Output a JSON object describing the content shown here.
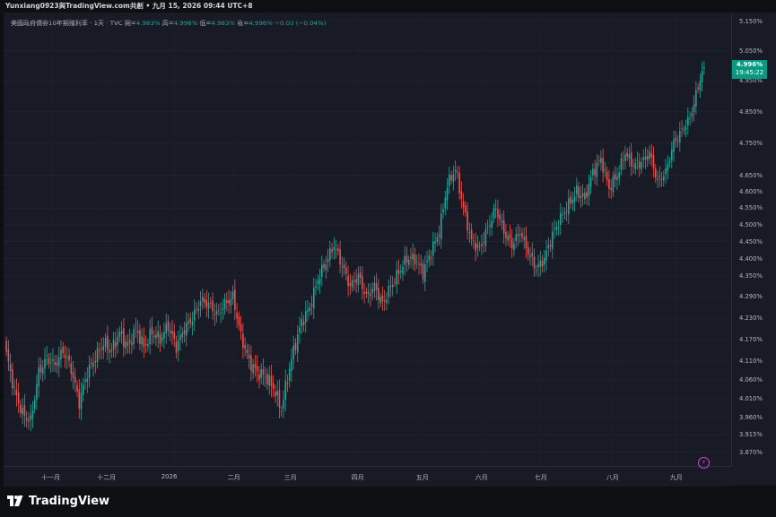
{
  "header": {
    "share_line": "Yunxiang0923與TradingView.com共創 • 九月 15, 2026 09:44 UTC+8"
  },
  "legend": {
    "symbol": "美國政府債券10年期殖利率 · 1天 · TVC",
    "open_label": "開=",
    "open_value": "4.983%",
    "high_label": "高=",
    "high_value": "4.996%",
    "low_label": "低=",
    "low_value": "4.983%",
    "close_label": "收=",
    "close_value": "4.996%",
    "change": "−0.00 (−0.04%)"
  },
  "last_price": {
    "value": "4.996%",
    "countdown": "19:45:22"
  },
  "footer": {
    "brand": "TradingView"
  },
  "colors": {
    "up": "#26a69a",
    "down": "#ef5350",
    "badge": "#089981",
    "bg": "#181a25"
  },
  "chart_data": {
    "type": "candlestick",
    "title": "美國政府債券10年期殖利率 · 1天 · TVC",
    "y_scale": "log",
    "ylim": [
      3.835,
      5.18
    ],
    "y_ticks": [
      "5.150%",
      "5.050%",
      "4.950%",
      "4.850%",
      "4.750%",
      "4.650%",
      "4.600%",
      "4.550%",
      "4.500%",
      "4.450%",
      "4.400%",
      "4.350%",
      "4.290%",
      "4.230%",
      "4.170%",
      "4.110%",
      "4.060%",
      "4.010%",
      "3.960%",
      "3.915%",
      "3.870%"
    ],
    "x_ticks": [
      "十一月",
      "十二月",
      "2026",
      "二月",
      "三月",
      "四月",
      "五月",
      "六月",
      "七月",
      "八月",
      "九月"
    ],
    "anchors": [
      [
        0,
        4.13
      ],
      [
        4,
        4.03
      ],
      [
        8,
        3.97
      ],
      [
        12,
        3.95
      ],
      [
        16,
        4.08
      ],
      [
        20,
        4.12
      ],
      [
        24,
        4.1
      ],
      [
        28,
        4.14
      ],
      [
        32,
        4.09
      ],
      [
        36,
        4.0
      ],
      [
        40,
        4.08
      ],
      [
        44,
        4.12
      ],
      [
        48,
        4.16
      ],
      [
        52,
        4.14
      ],
      [
        56,
        4.19
      ],
      [
        60,
        4.15
      ],
      [
        64,
        4.2
      ],
      [
        68,
        4.15
      ],
      [
        72,
        4.19
      ],
      [
        76,
        4.17
      ],
      [
        80,
        4.21
      ],
      [
        84,
        4.15
      ],
      [
        88,
        4.2
      ],
      [
        92,
        4.23
      ],
      [
        96,
        4.28
      ],
      [
        100,
        4.27
      ],
      [
        104,
        4.24
      ],
      [
        108,
        4.27
      ],
      [
        112,
        4.29
      ],
      [
        116,
        4.18
      ],
      [
        120,
        4.11
      ],
      [
        124,
        4.08
      ],
      [
        128,
        4.07
      ],
      [
        132,
        4.04
      ],
      [
        136,
        3.98
      ],
      [
        138,
        4.04
      ],
      [
        142,
        4.14
      ],
      [
        146,
        4.22
      ],
      [
        150,
        4.26
      ],
      [
        154,
        4.34
      ],
      [
        158,
        4.39
      ],
      [
        162,
        4.44
      ],
      [
        166,
        4.38
      ],
      [
        170,
        4.32
      ],
      [
        174,
        4.35
      ],
      [
        178,
        4.29
      ],
      [
        182,
        4.32
      ],
      [
        186,
        4.27
      ],
      [
        190,
        4.32
      ],
      [
        194,
        4.36
      ],
      [
        198,
        4.4
      ],
      [
        202,
        4.4
      ],
      [
        206,
        4.36
      ],
      [
        210,
        4.42
      ],
      [
        214,
        4.48
      ],
      [
        218,
        4.62
      ],
      [
        222,
        4.67
      ],
      [
        226,
        4.55
      ],
      [
        230,
        4.45
      ],
      [
        234,
        4.43
      ],
      [
        238,
        4.49
      ],
      [
        242,
        4.55
      ],
      [
        246,
        4.48
      ],
      [
        250,
        4.44
      ],
      [
        254,
        4.48
      ],
      [
        258,
        4.42
      ],
      [
        262,
        4.37
      ],
      [
        266,
        4.4
      ],
      [
        270,
        4.47
      ],
      [
        274,
        4.52
      ],
      [
        278,
        4.56
      ],
      [
        282,
        4.6
      ],
      [
        286,
        4.58
      ],
      [
        290,
        4.66
      ],
      [
        294,
        4.7
      ],
      [
        298,
        4.61
      ],
      [
        302,
        4.65
      ],
      [
        306,
        4.72
      ],
      [
        310,
        4.68
      ],
      [
        314,
        4.69
      ],
      [
        318,
        4.72
      ],
      [
        322,
        4.63
      ],
      [
        326,
        4.66
      ],
      [
        330,
        4.75
      ],
      [
        334,
        4.79
      ],
      [
        338,
        4.83
      ],
      [
        342,
        4.93
      ],
      [
        344,
        4.983
      ],
      [
        345,
        4.996
      ]
    ]
  }
}
